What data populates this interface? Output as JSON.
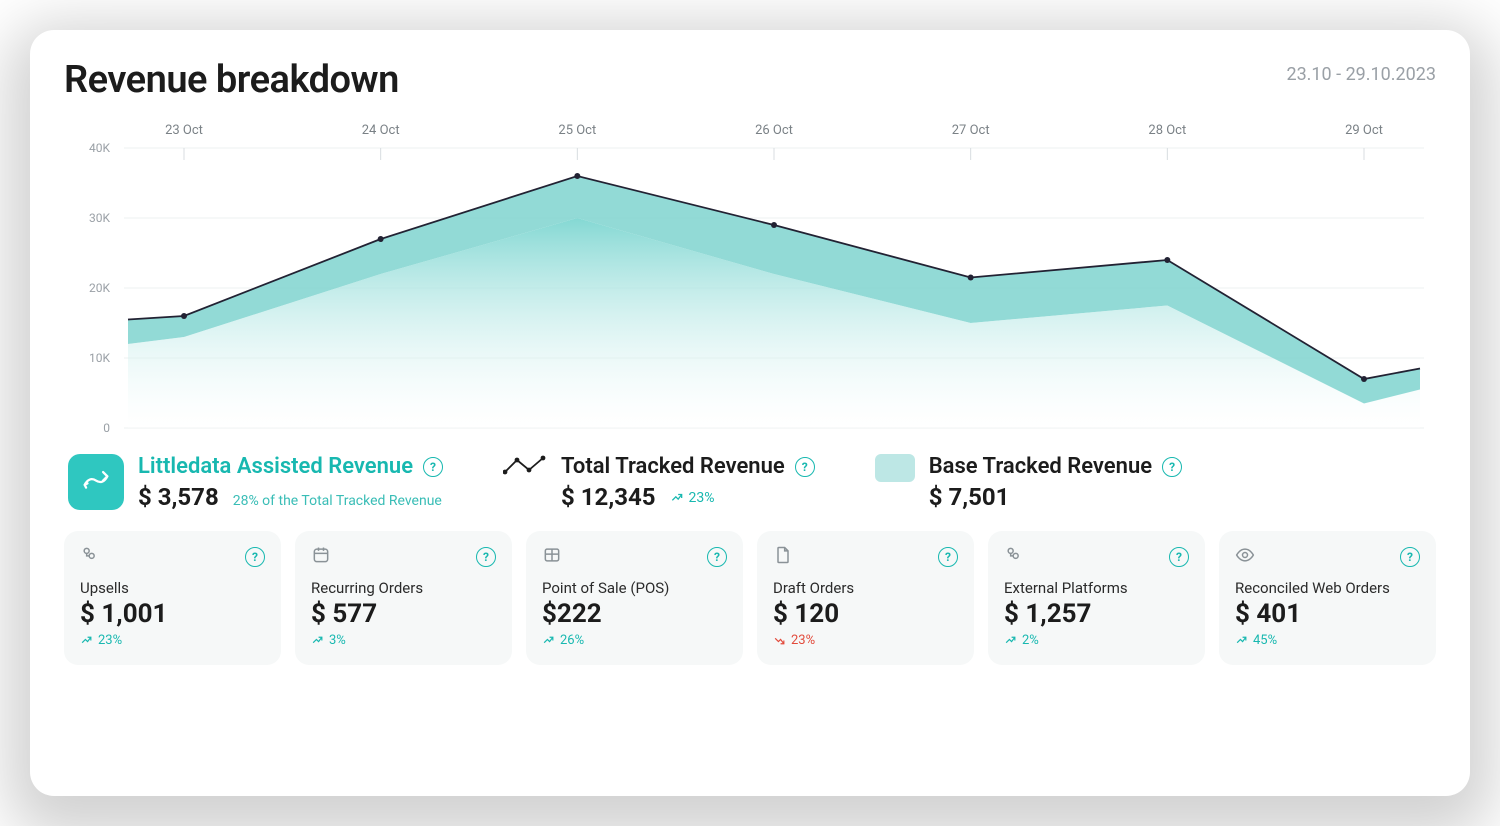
{
  "header": {
    "title": "Revenue breakdown",
    "date_range": "23.10 - 29.10.2023"
  },
  "chart_data": {
    "type": "area",
    "title": "Revenue breakdown",
    "xlabel": "",
    "ylabel": "",
    "ylim": [
      0,
      40000
    ],
    "yticks": [
      "0",
      "10K",
      "20K",
      "30K",
      "40K"
    ],
    "categories": [
      "23 Oct",
      "24 Oct",
      "25 Oct",
      "26 Oct",
      "27 Oct",
      "28 Oct",
      "29 Oct"
    ],
    "series": [
      {
        "name": "Total Tracked Revenue",
        "values": [
          16000,
          27000,
          36000,
          29000,
          21500,
          24000,
          7000
        ],
        "style": "line"
      },
      {
        "name": "Base Tracked Revenue",
        "values": [
          13000,
          22000,
          30000,
          22000,
          15000,
          17500,
          3500
        ],
        "style": "area"
      }
    ],
    "edge_points": {
      "right_total": 8500,
      "right_base": 5500,
      "left_total": 15500,
      "left_base": 12000
    }
  },
  "legend": {
    "assisted": {
      "title": "Littledata Assisted Revenue",
      "value": "$ 3,578",
      "subtext": "28% of the Total Tracked Revenue"
    },
    "total": {
      "title": "Total Tracked Revenue",
      "value": "$ 12,345",
      "trend": "23%",
      "trend_dir": "up"
    },
    "base": {
      "title": "Base Tracked Revenue",
      "value": "$ 7,501"
    }
  },
  "metrics": [
    {
      "icon": "layers-icon",
      "label": "Upsells",
      "value": "$ 1,001",
      "trend": "23%",
      "dir": "up"
    },
    {
      "icon": "calendar-icon",
      "label": "Recurring Orders",
      "value": "$ 577",
      "trend": "3%",
      "dir": "up"
    },
    {
      "icon": "table-icon",
      "label": "Point of Sale (POS)",
      "value": "$222",
      "trend": "26%",
      "dir": "up"
    },
    {
      "icon": "file-icon",
      "label": "Draft Orders",
      "value": "$ 120",
      "trend": "23%",
      "dir": "down"
    },
    {
      "icon": "layers-icon",
      "label": "External Platforms",
      "value": "$ 1,257",
      "trend": "2%",
      "dir": "up"
    },
    {
      "icon": "eye-icon",
      "label": "Reconciled Web Orders",
      "value": "$ 401",
      "trend": "45%",
      "dir": "up"
    }
  ]
}
